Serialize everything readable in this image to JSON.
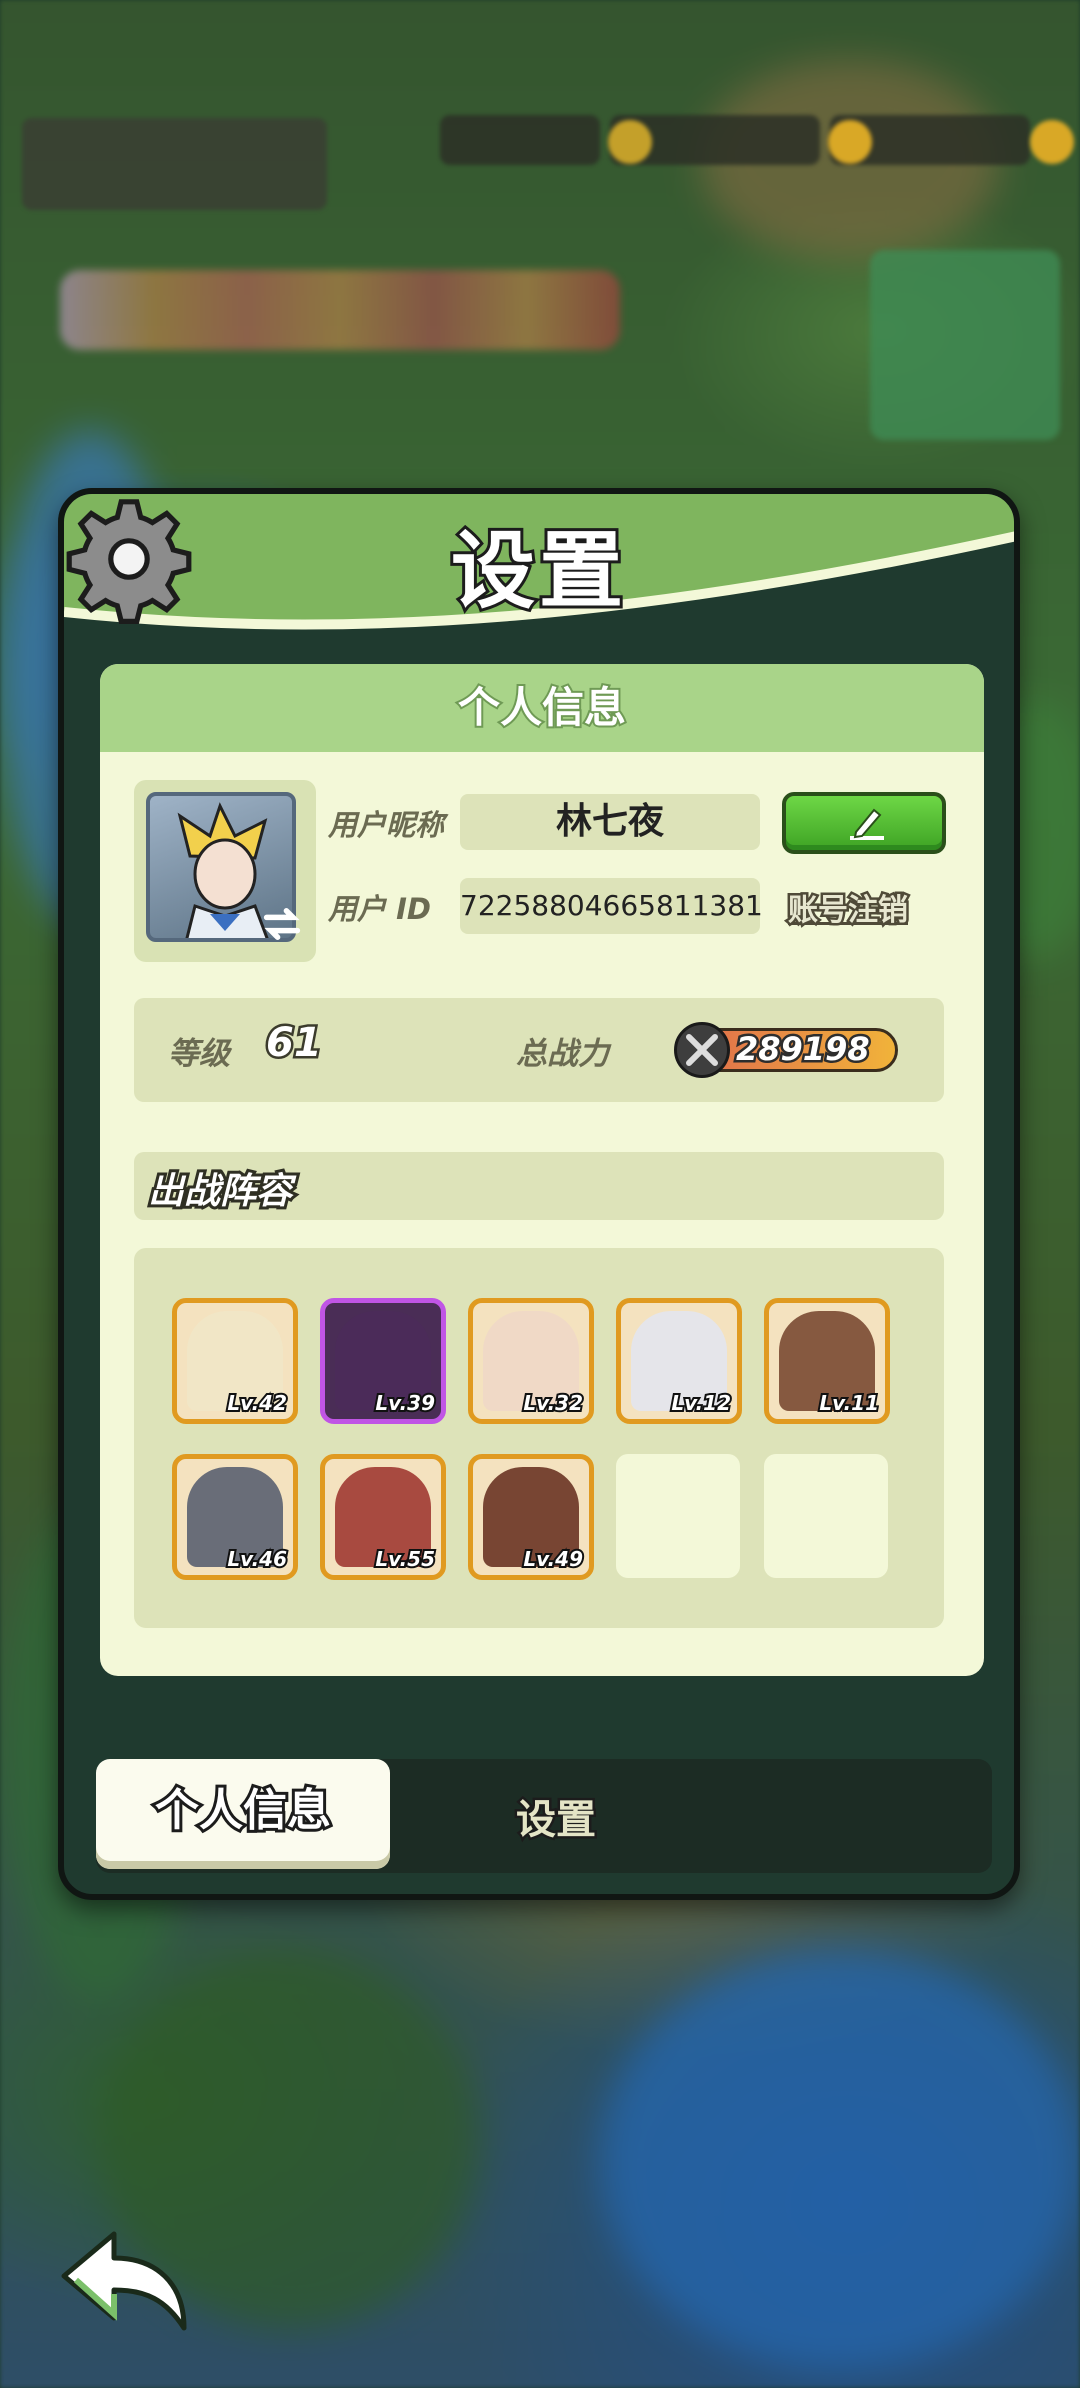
{
  "dialog": {
    "title": "设置",
    "panel_header": "个人信息"
  },
  "profile": {
    "nickname_label": "用户昵称",
    "nickname": "林七夜",
    "id_label": "用户  ID",
    "user_id": "72258804665811381",
    "logout_label": "账号注销",
    "level_label": "等级",
    "level": "61",
    "power_label": "总战力",
    "power": "289198"
  },
  "lineup": {
    "title": "出战阵容",
    "heroes": [
      {
        "level": "Lv.42",
        "rarity": "legendary",
        "color": "#f1e7c6"
      },
      {
        "level": "Lv.39",
        "rarity": "epic",
        "color": "#4b2b5a"
      },
      {
        "level": "Lv.32",
        "rarity": "legendary",
        "color": "#f0d8c6"
      },
      {
        "level": "Lv.12",
        "rarity": "legendary",
        "color": "#e3e6ee"
      },
      {
        "level": "Lv.11",
        "rarity": "legendary",
        "color": "#7a4a32"
      },
      {
        "level": "Lv.46",
        "rarity": "legendary",
        "color": "#5a6070"
      },
      {
        "level": "Lv.55",
        "rarity": "legendary",
        "color": "#a03a32"
      },
      {
        "level": "Lv.49",
        "rarity": "legendary",
        "color": "#6a3424"
      }
    ],
    "empty_slots": 2
  },
  "tabs": [
    {
      "label": "个人信息",
      "active": true
    },
    {
      "label": "设置",
      "active": false
    }
  ],
  "icons": {
    "settings": "gear-icon",
    "edit": "pencil-icon",
    "power": "crossed-swords-icon",
    "back": "back-arrow-icon",
    "swap": "swap-arrows-icon"
  },
  "colors": {
    "header_green": "#7fb55e",
    "panel_bg": "#f3f8d8",
    "edit_button": "#4cbf2f",
    "epic_border": "#c055e5",
    "legendary_border": "#e09a20"
  }
}
